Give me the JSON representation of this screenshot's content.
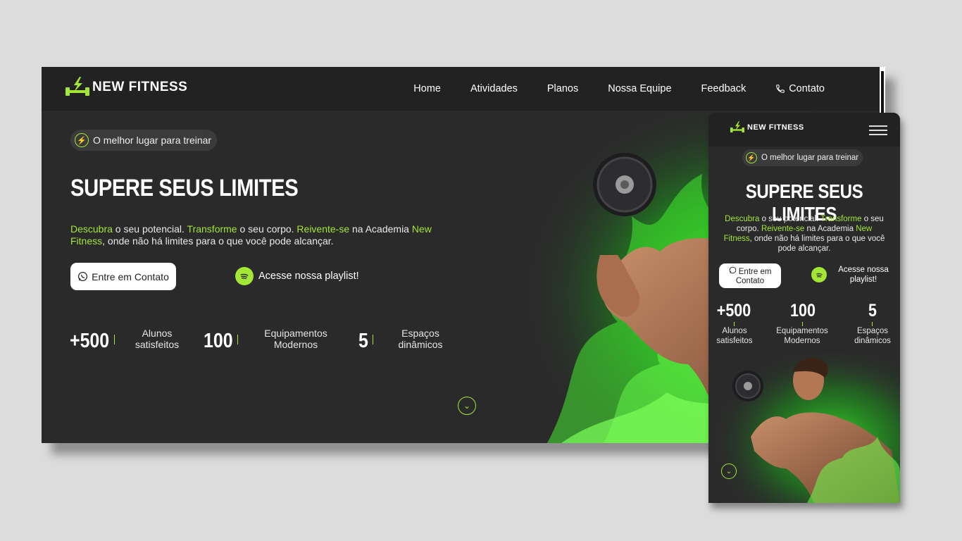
{
  "brand": {
    "name": "NEW FITNESS"
  },
  "nav": {
    "items": [
      {
        "label": "Home"
      },
      {
        "label": "Atividades"
      },
      {
        "label": "Planos"
      },
      {
        "label": "Nossa Equipe"
      },
      {
        "label": "Feedback"
      },
      {
        "label": "Contato",
        "icon": "phone-icon"
      }
    ],
    "menu_icon": "hamburger-menu-icon"
  },
  "hero": {
    "badge": "O melhor lugar para treinar",
    "badge_icon": "bolt-icon",
    "title": "SUPERE SEUS LIMITES",
    "lead": {
      "w1": "Descubra",
      "t1": " o seu potencial. ",
      "w2": "Transforme",
      "t2": " o seu corpo. ",
      "w3": "Reivente-se",
      "t3": " na Academia ",
      "w4": "New Fitness",
      "t4": ", onde não há limites para o que você pode alcançar."
    },
    "contact_button": "Entre em Contato",
    "contact_icon": "whatsapp-icon",
    "playlist_label": "Acesse nossa playlist!",
    "playlist_icon": "spotify-icon",
    "scroll_icon": "chevron-down-icon"
  },
  "stats": [
    {
      "value": "+500",
      "label": "Alunos satisfeitos"
    },
    {
      "value": "100",
      "label": "Equipamentos Modernos"
    },
    {
      "value": "5",
      "label": "Espaços dinâmicos"
    }
  ],
  "colors": {
    "accent": "#a4e635",
    "background": "#2a2a2a",
    "navbar": "#222222",
    "page": "#dcdcdc"
  }
}
